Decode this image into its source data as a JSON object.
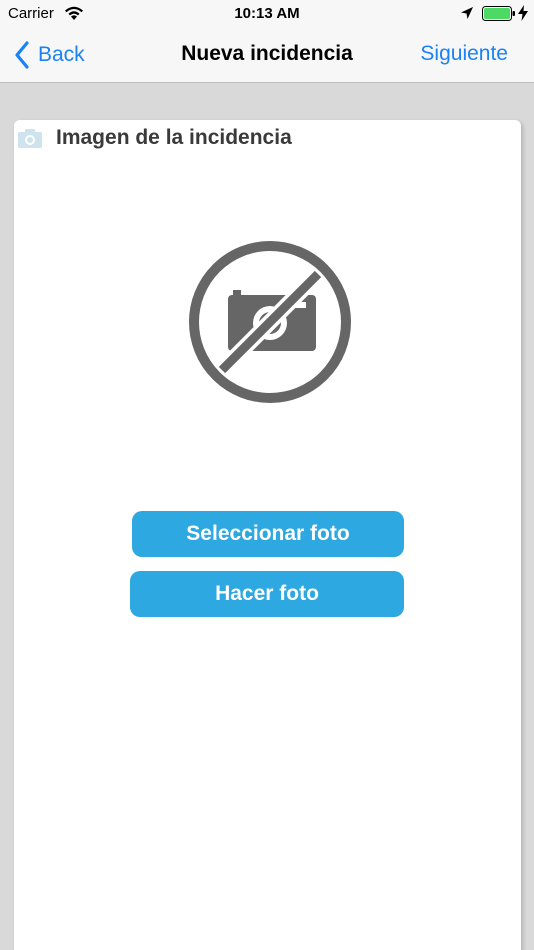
{
  "status_bar": {
    "carrier": "Carrier",
    "time": "10:13 AM",
    "icons": [
      "wifi-icon",
      "location-arrow-icon",
      "battery-icon",
      "charging-bolt-icon"
    ]
  },
  "nav": {
    "back_label": "Back",
    "title": "Nueva incidencia",
    "next_label": "Siguiente",
    "accent_color": "#1a82f5"
  },
  "card": {
    "title": "Imagen de la incidencia",
    "header_icon": "camera-icon",
    "placeholder_icon": "no-camera-icon",
    "buttons": {
      "select_photo": "Seleccionar foto",
      "take_photo": "Hacer foto"
    },
    "button_color": "#2ea8e0"
  }
}
